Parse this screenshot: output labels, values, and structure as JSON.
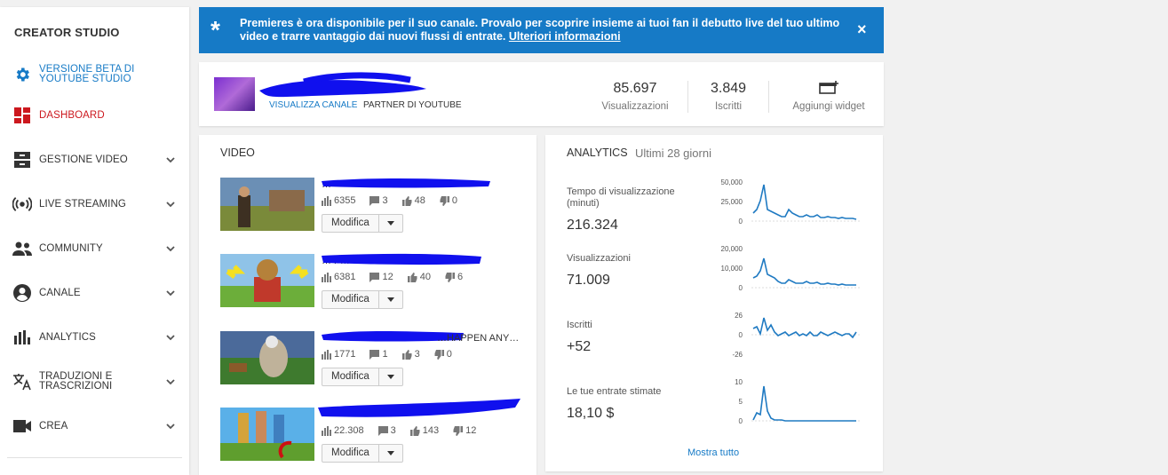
{
  "sidebar": {
    "title": "CREATOR STUDIO",
    "items": [
      {
        "label": "VERSIONE BETA DI YOUTUBE STUDIO",
        "icon": "gear-icon",
        "color": "#167ac6",
        "chevron": false
      },
      {
        "label": "DASHBOARD",
        "icon": "dashboard-icon",
        "color": "#cc181e",
        "chevron": false
      },
      {
        "label": "GESTIONE VIDEO",
        "icon": "video-manager-icon",
        "color": "#333333",
        "chevron": true
      },
      {
        "label": "LIVE STREAMING",
        "icon": "live-icon",
        "color": "#333333",
        "chevron": true
      },
      {
        "label": "COMMUNITY",
        "icon": "people-icon",
        "color": "#333333",
        "chevron": true
      },
      {
        "label": "CANALE",
        "icon": "account-icon",
        "color": "#333333",
        "chevron": true
      },
      {
        "label": "ANALYTICS",
        "icon": "bar-chart-icon",
        "color": "#333333",
        "chevron": true
      },
      {
        "label": "TRADUZIONI E TRASCRIZIONI",
        "icon": "translate-icon",
        "color": "#333333",
        "chevron": true
      },
      {
        "label": "CREA",
        "icon": "camera-icon",
        "color": "#333333",
        "chevron": true
      }
    ]
  },
  "banner": {
    "message": "Premieres è ora disponibile per il suo canale. Provalo per scoprire insieme ai tuoi fan il debutto live del tuo ultimo video e trarre vantaggio dai nuovi flussi di entrate.",
    "link": "Ulteriori informazioni",
    "close": "×",
    "color": "#167ac6"
  },
  "channel": {
    "view_channel": "VISUALIZZA CANALE",
    "partner": "PARTNER DI YOUTUBE",
    "views": {
      "value": "85.697",
      "label": "Visualizzazioni"
    },
    "subscribers": {
      "value": "3.849",
      "label": "Iscritti"
    },
    "widget": {
      "label": "Aggiungi widget"
    }
  },
  "videos": {
    "heading": "VIDEO",
    "edit_label": "Modifica",
    "items": [
      {
        "title": "…",
        "views": "6355",
        "comments": "3",
        "likes": "48",
        "dislikes": "0"
      },
      {
        "title": "… F…",
        "views": "6381",
        "comments": "12",
        "likes": "40",
        "dislikes": "6"
      },
      {
        "title": "…HAPPEN ANY…",
        "views": "1771",
        "comments": "1",
        "likes": "3",
        "dislikes": "0"
      },
      {
        "title": "",
        "views": "22.308",
        "comments": "3",
        "likes": "143",
        "dislikes": "12"
      }
    ]
  },
  "analytics": {
    "heading": "ANALYTICS",
    "period": "Ultimi 28 giorni",
    "show_all": "Mostra tutto",
    "metrics": [
      {
        "label": "Tempo di visualizzazione (minuti)",
        "value": "216.324",
        "ticks": [
          "50,000",
          "25,000",
          "0"
        ]
      },
      {
        "label": "Visualizzazioni",
        "value": "71.009",
        "ticks": [
          "20,000",
          "10,000",
          "0"
        ]
      },
      {
        "label": "Iscritti",
        "value": "+52",
        "ticks": [
          "26",
          "0",
          "-26"
        ]
      },
      {
        "label": "Le tue entrate stimate",
        "value": "18,10 $",
        "ticks": [
          "10",
          "5",
          "0"
        ]
      }
    ]
  }
}
